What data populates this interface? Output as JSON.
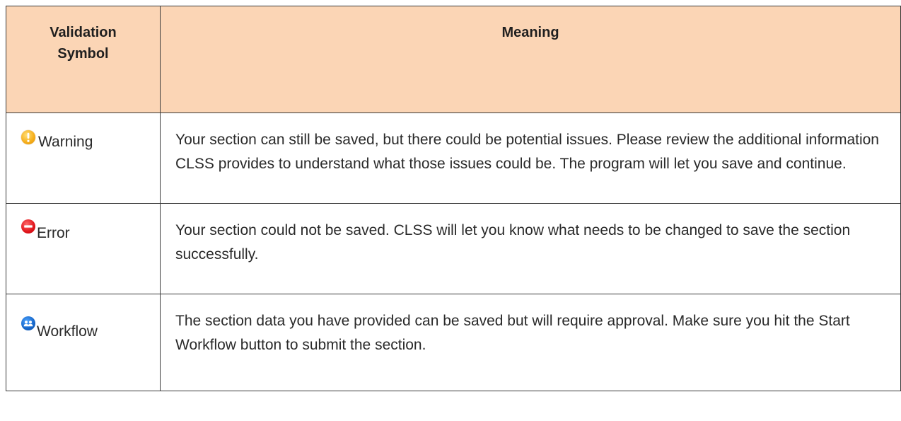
{
  "table": {
    "header": {
      "symbol_col": "Validation Symbol",
      "meaning_col": "Meaning"
    },
    "rows": [
      {
        "symbol_label": "Warning",
        "icon": "warning-icon",
        "icon_color": "#f6b01e",
        "meaning": "Your section can still be saved, but there could be potential issues. Please review the additional information CLSS provides to understand what those issues could be. The program will let you save and continue."
      },
      {
        "symbol_label": "Error",
        "icon": "error-icon",
        "icon_color": "#e0141a",
        "meaning": "Your section could not be saved. CLSS will let you know what needs to be changed to save the section successfully."
      },
      {
        "symbol_label": "Workflow",
        "icon": "workflow-icon",
        "icon_color": "#1565c8",
        "meaning": "The section data you have provided can be saved but will require approval. Make sure you hit the Start Workflow button to submit the section."
      }
    ]
  },
  "colors": {
    "header_bg": "#fbd5b5",
    "border": "#3a3a3a",
    "text": "#2a2a2a"
  }
}
